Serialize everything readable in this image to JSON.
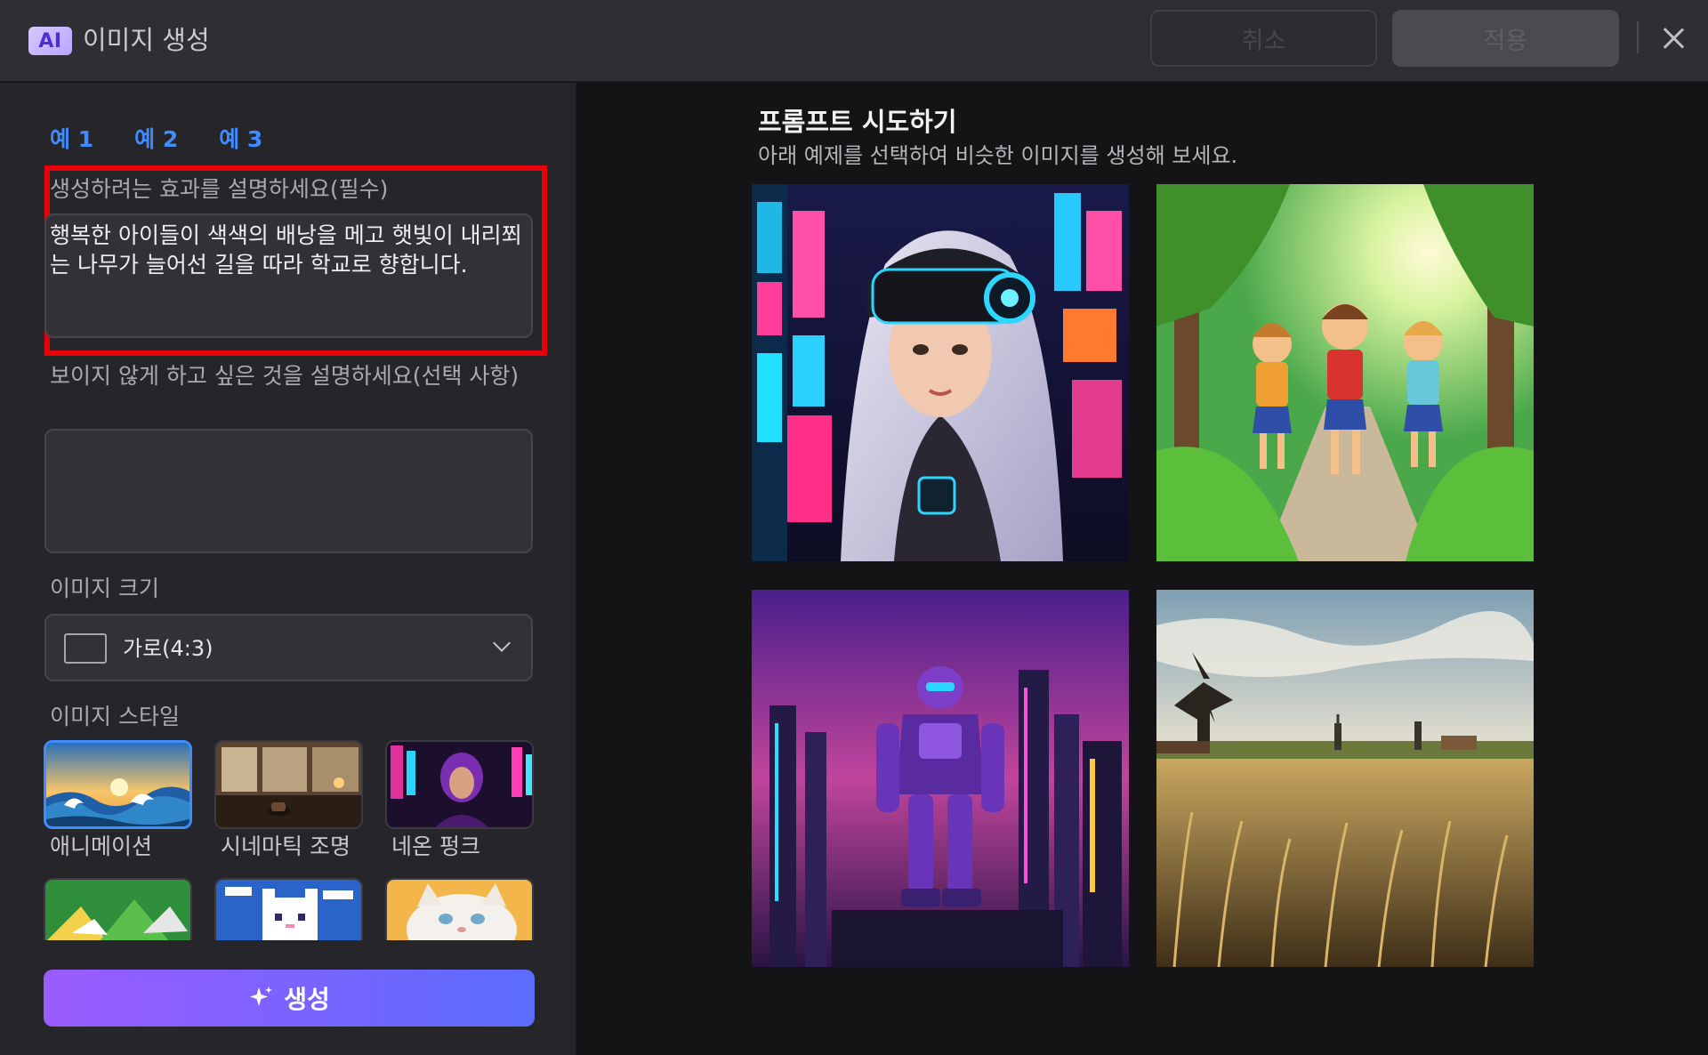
{
  "header": {
    "badge": "AI",
    "title": "이미지 생성",
    "cancel_label": "취소",
    "apply_label": "적용"
  },
  "left": {
    "examples": [
      "예 1",
      "예 2",
      "예 3"
    ],
    "prompt": {
      "label": "생성하려는 효과를 설명하세요(필수)",
      "value": "행복한 아이들이 색색의 배낭을 메고 햇빛이 내리쬐는 나무가 늘어선 길을 따라 학교로 향합니다."
    },
    "negative": {
      "label": "보이지 않게 하고 싶은 것을 설명하세요(선택 사항)",
      "value": ""
    },
    "size": {
      "label": "이미지 크기",
      "value": "가로(4:3)"
    },
    "style": {
      "label": "이미지 스타일",
      "items": [
        {
          "label": "애니메이션",
          "selected": true
        },
        {
          "label": "시네마틱 조명",
          "selected": false
        },
        {
          "label": "네온 펑크",
          "selected": false
        },
        {
          "label": "",
          "selected": false
        },
        {
          "label": "",
          "selected": false
        },
        {
          "label": "",
          "selected": false
        }
      ]
    },
    "generate_label": "생성"
  },
  "right": {
    "title": "프롬프트 시도하기",
    "subtitle": "아래 예제를 선택하여 비슷한 이미지를 생성해 보세요."
  },
  "colors": {
    "accent": "#3f8cff",
    "highlight": "#e8000b",
    "generate_start": "#9b5cff",
    "generate_end": "#5b6dff"
  }
}
